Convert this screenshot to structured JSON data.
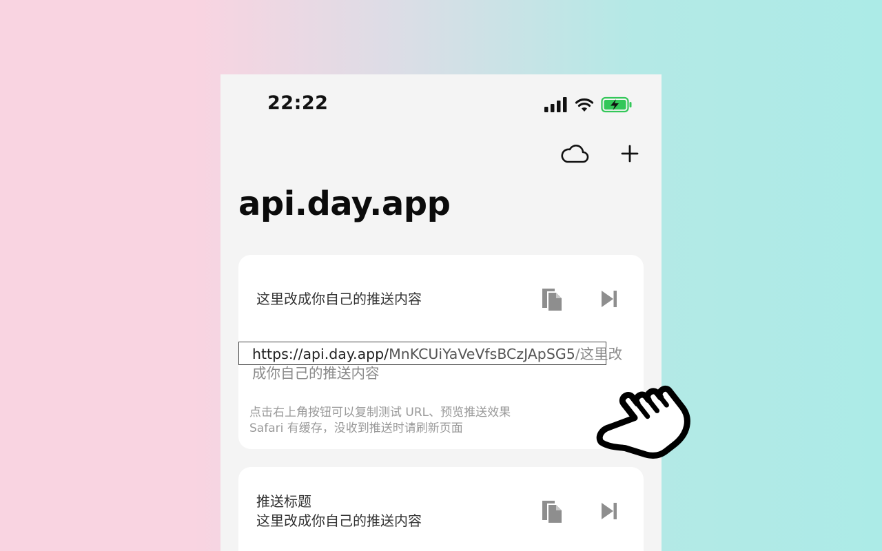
{
  "status": {
    "time": "22:22"
  },
  "nav": {
    "title": "api.day.app"
  },
  "card1": {
    "content": "这里改成你自己的推送内容",
    "url_host": "https://api.day.app/",
    "url_key": "MnKCUiYaVeVfsBCzJApSG5",
    "url_suffix": "/这里改成你自己的推送内容",
    "hint_line1": "点击右上角按钮可以复制测试 URL、预览推送效果",
    "hint_line2": "Safari 有缓存，没收到推送时请刷新页面"
  },
  "card2": {
    "title": "推送标题",
    "content": "这里改成你自己的推送内容"
  },
  "icons": {
    "cloud": "cloud-icon",
    "add": "plus-icon",
    "copy": "copy-icon",
    "preview": "skip-forward-icon",
    "pointer": "hand-pointer-icon"
  },
  "colors": {
    "battery_fill": "#33c759",
    "action_icon": "#8e8e8e",
    "background_left": "#f9d4e1",
    "background_right": "#acebe7"
  }
}
